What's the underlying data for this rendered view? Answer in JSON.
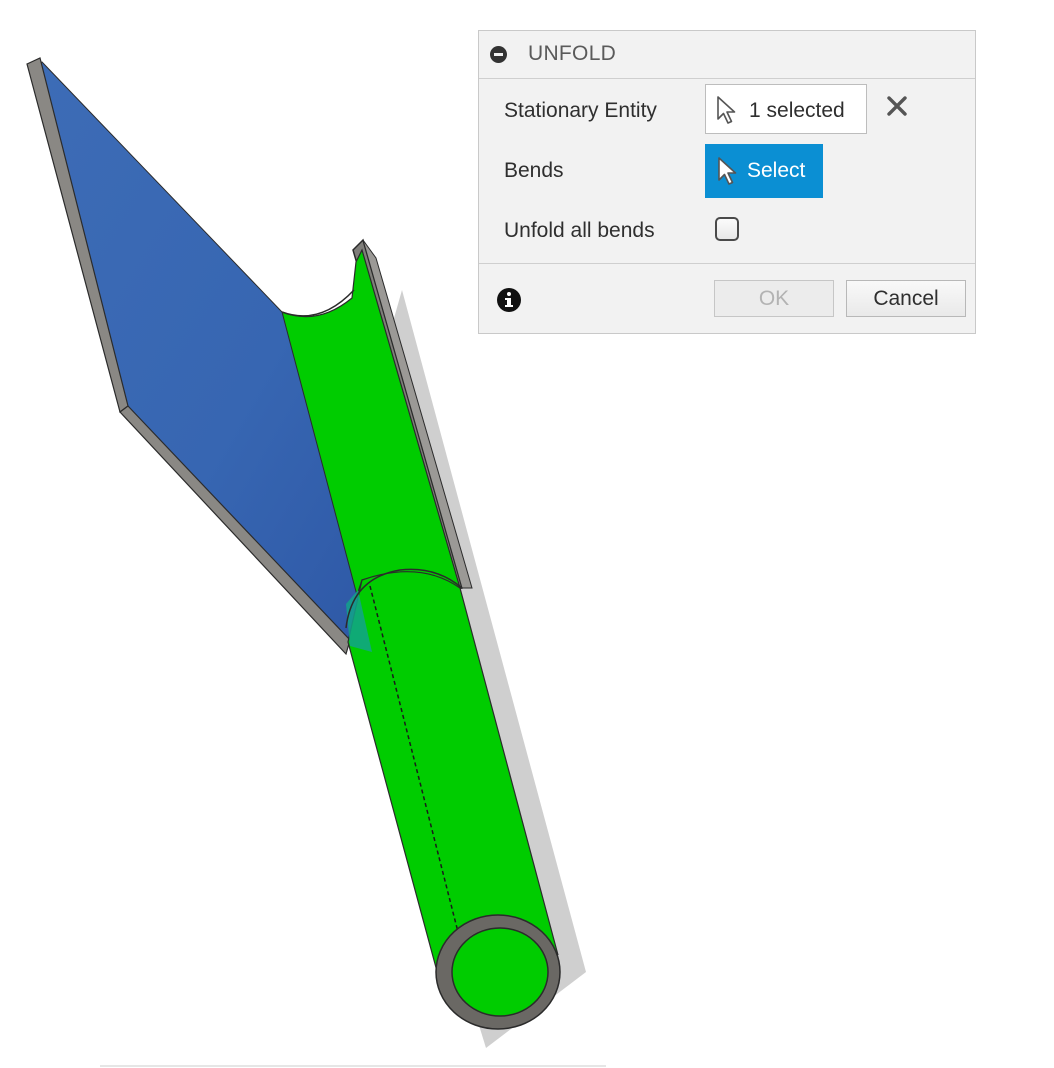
{
  "dialog": {
    "title": "UNFOLD",
    "collapse_icon": "minus-circle-icon",
    "rows": {
      "stationary_entity": {
        "label": "Stationary Entity",
        "selection": "1 selected",
        "cursor_icon": "pointer-arrow-icon",
        "clear_icon": "close-x-icon"
      },
      "bends": {
        "label": "Bends",
        "selection": "Select",
        "cursor_icon": "pointer-arrow-icon"
      },
      "unfold_all_bends": {
        "label": "Unfold all bends",
        "checked": false
      }
    },
    "footer": {
      "info_icon": "info-icon",
      "ok_label": "OK",
      "ok_enabled": false,
      "cancel_label": "Cancel"
    }
  },
  "colors": {
    "flange_face": "#3a6ab5",
    "bend_face_highlight": "#00cc00",
    "edge": "#7d7b77",
    "select_button": "#0b8fd3"
  }
}
